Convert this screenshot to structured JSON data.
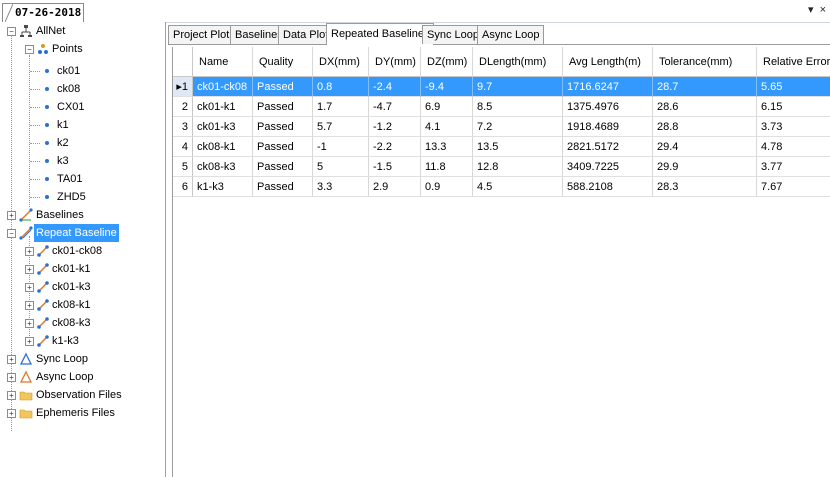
{
  "window": {
    "doc_tab": "07-26-2018",
    "controls": [
      "▾",
      "×"
    ]
  },
  "tree": {
    "root": "AllNet",
    "points_label": "Points",
    "points": [
      "ck01",
      "ck08",
      "CX01",
      "k1",
      "k2",
      "k3",
      "TA01",
      "ZHD5"
    ],
    "baselines_label": "Baselines",
    "repeat_baseline_label": "Repeat Baseline",
    "repeat_items": [
      "ck01-ck08",
      "ck01-k1",
      "ck01-k3",
      "ck08-k1",
      "ck08-k3",
      "k1-k3"
    ],
    "sync_loop_label": "Sync Loop",
    "async_loop_label": "Async Loop",
    "observation_files_label": "Observation Files",
    "ephemeris_files_label": "Ephemeris Files"
  },
  "tabs": [
    "Project Plot",
    "Baselines",
    "Data Plot",
    "Repeated Baselines",
    "Sync Loop",
    "Async Loop"
  ],
  "active_tab": "Repeated Baselines",
  "table": {
    "columns": [
      "Name",
      "Quality",
      "DX(mm)",
      "DY(mm)",
      "DZ(mm)",
      "DLength(mm)",
      "Avg Length(m)",
      "Tolerance(mm)",
      "Relative Error("
    ],
    "rows": [
      {
        "num": "1",
        "cells": [
          "ck01-ck08",
          "Passed",
          "0.8",
          "-2.4",
          "-9.4",
          "9.7",
          "1716.6247",
          "28.7",
          "5.65"
        ]
      },
      {
        "num": "2",
        "cells": [
          "ck01-k1",
          "Passed",
          "1.7",
          "-4.7",
          "6.9",
          "8.5",
          "1375.4976",
          "28.6",
          "6.15"
        ]
      },
      {
        "num": "3",
        "cells": [
          "ck01-k3",
          "Passed",
          "5.7",
          "-1.2",
          "4.1",
          "7.2",
          "1918.4689",
          "28.8",
          "3.73"
        ]
      },
      {
        "num": "4",
        "cells": [
          "ck08-k1",
          "Passed",
          "-1",
          "-2.2",
          "13.3",
          "13.5",
          "2821.5172",
          "29.4",
          "4.78"
        ]
      },
      {
        "num": "5",
        "cells": [
          "ck08-k3",
          "Passed",
          "5",
          "-1.5",
          "11.8",
          "12.8",
          "3409.7225",
          "29.9",
          "3.77"
        ]
      },
      {
        "num": "6",
        "cells": [
          "k1-k3",
          "Passed",
          "3.3",
          "2.9",
          "0.9",
          "4.5",
          "588.2108",
          "28.3",
          "7.67"
        ]
      }
    ],
    "selected_row_marker": "▸"
  },
  "colors": {
    "selection": "#3399ff",
    "folder": "#f3c65b",
    "point_blue": "#2a6fd6",
    "baseline_orange": "#e0782a"
  }
}
